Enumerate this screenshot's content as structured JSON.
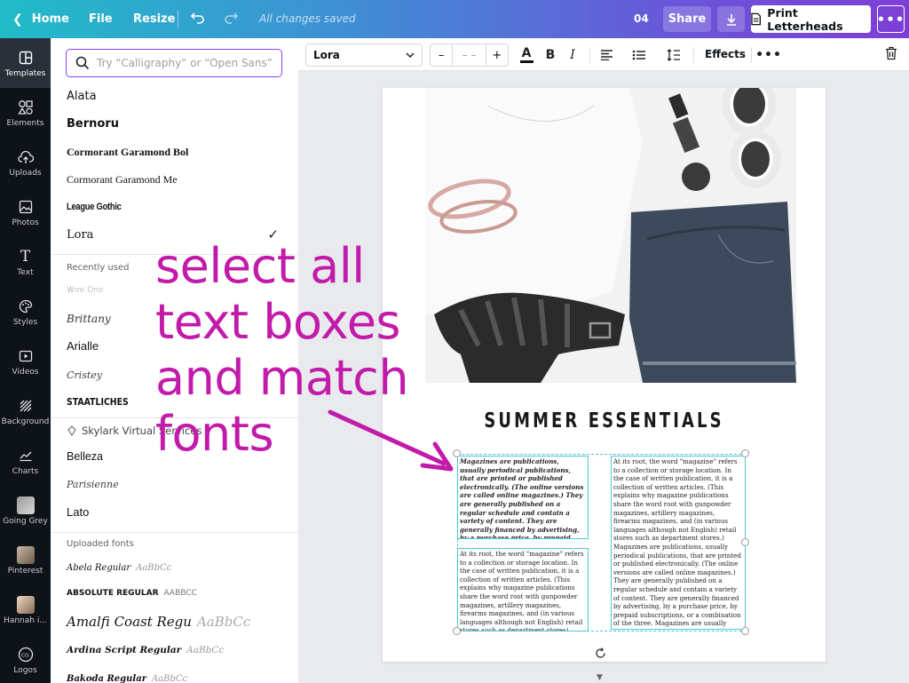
{
  "topbar": {
    "home": "Home",
    "file": "File",
    "resize": "Resize",
    "status": "All changes saved",
    "page_count": "04",
    "share": "Share",
    "print": "Print Letterheads"
  },
  "rail": {
    "items": [
      {
        "label": "Templates",
        "icon": "templates-icon"
      },
      {
        "label": "Elements",
        "icon": "elements-icon"
      },
      {
        "label": "Uploads",
        "icon": "uploads-icon"
      },
      {
        "label": "Photos",
        "icon": "photos-icon"
      },
      {
        "label": "Text",
        "icon": "text-icon"
      },
      {
        "label": "Styles",
        "icon": "styles-icon"
      },
      {
        "label": "Videos",
        "icon": "videos-icon"
      },
      {
        "label": "Background",
        "icon": "background-icon"
      },
      {
        "label": "Charts",
        "icon": "charts-icon"
      },
      {
        "label": "Going Grey",
        "icon": "folder-thumbnail"
      },
      {
        "label": "Pinterest",
        "icon": "folder-thumbnail"
      },
      {
        "label": "Hannah i...",
        "icon": "folder-thumbnail"
      },
      {
        "label": "Logos",
        "icon": "logos-icon"
      }
    ]
  },
  "panel": {
    "search_placeholder": "Try “Calligraphy” or “Open Sans”",
    "fonts": [
      "Alata",
      "Bernoru",
      "Cormorant Garamond Bol",
      "Cormorant Garamond Me",
      "League Gothic",
      "Lora"
    ],
    "selected_font": "Lora",
    "recently_used_label": "Recently used",
    "recent": [
      "Wire One",
      "Brittany",
      "Arialle",
      "Cristey",
      "STAATLICHES"
    ],
    "virtual_services": "Skylark Virtual Services",
    "brand_fonts": [
      "Belleza",
      "Parisienne",
      "Lato"
    ],
    "uploaded_label": "Uploaded fonts",
    "uploaded": [
      {
        "name": "Abela Regular",
        "sample": "AaBbCc"
      },
      {
        "name": "ABSOLUTE REGULAR",
        "sample": "AABBCC"
      },
      {
        "name": "Amalfi Coast Regu",
        "sample": "AaBbCc"
      },
      {
        "name": "Ardina Script Regular",
        "sample": "AaBbCc"
      },
      {
        "name": "Bakoda Regular",
        "sample": "AaBbCc"
      }
    ]
  },
  "toolbar": {
    "font": "Lora",
    "size_minus": "–",
    "size_value": "– –",
    "size_plus": "+",
    "text_color_letter": "A",
    "bold": "B",
    "italic": "I",
    "effects": "Effects"
  },
  "canvas": {
    "headline": "SUMMER ESSENTIALS",
    "box1": "Magazines are publications, usually periodical publications, that are printed or published electronically. (The online versions are called online magazines.) They are generally published on a regular schedule and contain a variety of content. They are generally financed by advertising, by a purchase price, by prepaid subscriptions, or a combination of the three.",
    "box2": "At its root, the word \"magazine\" refers to a collection or storage location. In the case of written publication, it is a collection of written articles. (This explains why magazine publications share the word root with gunpowder magazines, artillery magazines, firearms magazines, and (in various languages although not English) retail stores such as department stores).",
    "box3": "At its root, the word \"magazine\" refers to a collection or storage location. In the case of written publication, it is a collection of written articles. (This explains why magazine publications share the word root with gunpowder magazines, artillery magazines, firearms magazines, and (in various languages although not English) retail stores such as department stores.) Magazines are publications, usually periodical publications, that are printed or published electronically. (The online versions are called online magazines.) They are generally published on a regular schedule and contain a variety of content. They are generally financed by advertising, by a purchase price, by prepaid subscriptions, or a combination of the three. Magazines are usually periodical publications"
  },
  "annotation": {
    "lines": [
      "select all",
      "text boxes",
      "and match",
      "fonts"
    ]
  },
  "colors": {
    "accent_purple": "#8b3dff",
    "selection_teal": "#4cc9d4",
    "annotation_magenta": "#c21aa9",
    "rail_bg": "#0e1318"
  }
}
